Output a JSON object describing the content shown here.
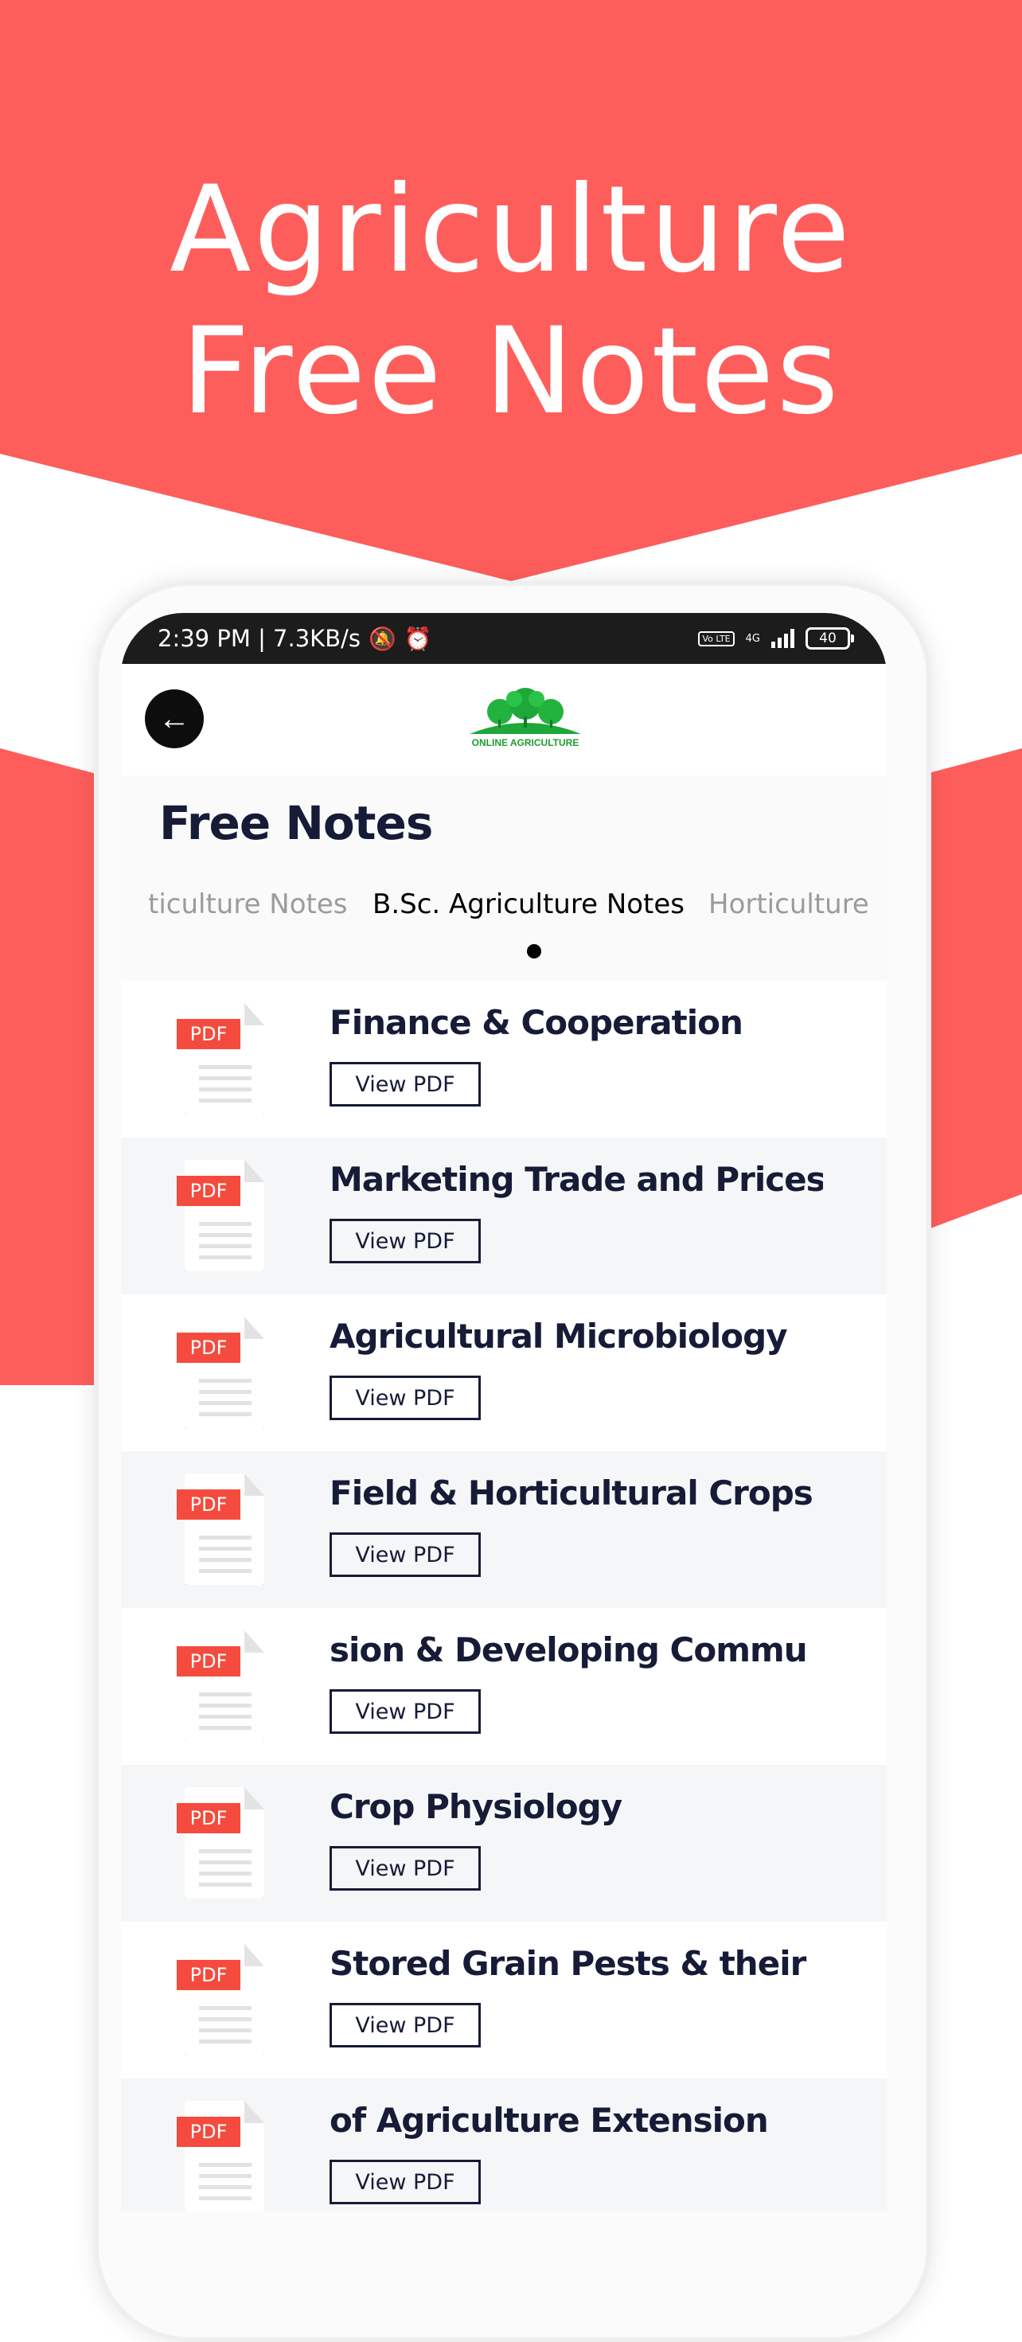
{
  "promo": {
    "headline_line1": "Agriculture",
    "headline_line2": "Free Notes",
    "accent_color": "#fe5e5b"
  },
  "status_bar": {
    "time_speed": "2:39 PM | 7.3KB/s",
    "network": "4G",
    "volte": "Vo LTE",
    "battery": "40"
  },
  "app_bar": {
    "back_icon": "arrow-left-icon",
    "logo_text": "ONLINE AGRICULTURE"
  },
  "page": {
    "title": "Free Notes"
  },
  "tabs": [
    {
      "label": "ticulture Notes",
      "active": false
    },
    {
      "label": "B.Sc. Agriculture Notes",
      "active": true
    },
    {
      "label": "Horticulture",
      "active": false
    }
  ],
  "notes": [
    {
      "title": "Finance & Cooperation",
      "button": "View PDF",
      "icon": "PDF"
    },
    {
      "title": "Marketing Trade and Prices",
      "button": "View PDF",
      "icon": "PDF"
    },
    {
      "title": "Agricultural Microbiology",
      "button": "View PDF",
      "icon": "PDF"
    },
    {
      "title": "Field & Horticultural Crops",
      "button": "View PDF",
      "icon": "PDF"
    },
    {
      "title": "sion & Developing Commu",
      "button": "View PDF",
      "icon": "PDF"
    },
    {
      "title": "Crop Physiology",
      "button": "View PDF",
      "icon": "PDF"
    },
    {
      "title": "Stored Grain Pests & their",
      "button": "View PDF",
      "icon": "PDF"
    },
    {
      "title": "of Agriculture Extension",
      "button": "View PDF",
      "icon": "PDF"
    }
  ]
}
